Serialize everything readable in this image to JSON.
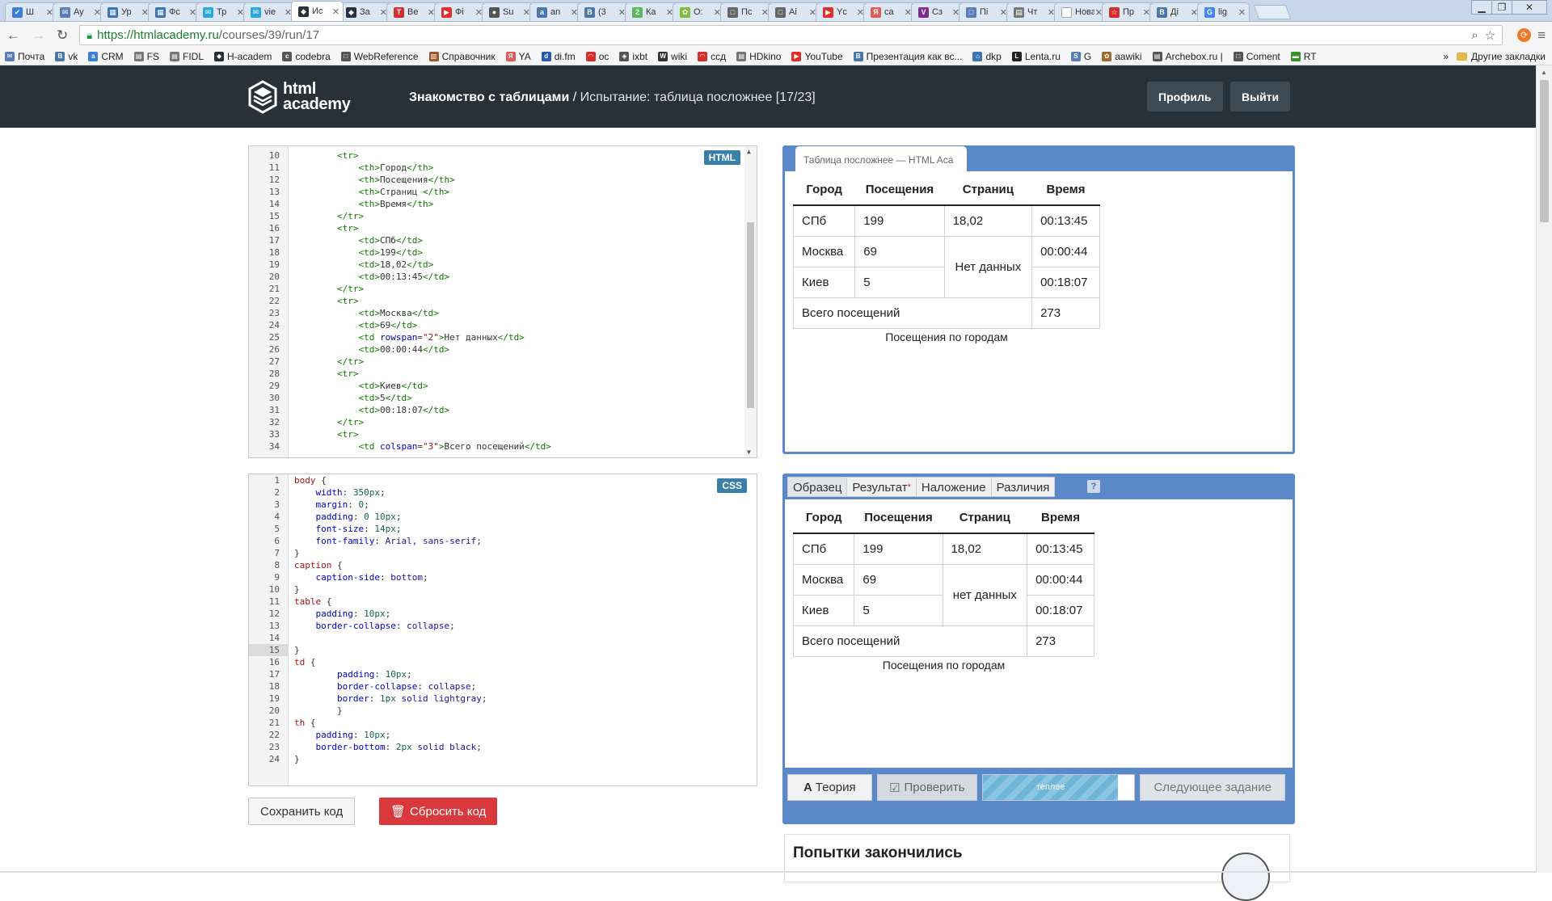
{
  "browser": {
    "tabs": [
      {
        "label": "Ш",
        "color": "#3b7dd8",
        "glyph": "✔"
      },
      {
        "label": "Ay",
        "color": "#5a7fb5",
        "glyph": "✉"
      },
      {
        "label": "Ур",
        "color": "#3d73b0",
        "glyph": "▦"
      },
      {
        "label": "Фс",
        "color": "#3d73b0",
        "glyph": "▦"
      },
      {
        "label": "Тр",
        "color": "#29a9e0",
        "glyph": "✉"
      },
      {
        "label": "vie",
        "color": "#29a9e0",
        "glyph": "✉"
      },
      {
        "label": "Ис",
        "color": "#283138",
        "glyph": "◆",
        "active": true
      },
      {
        "label": "За",
        "color": "#283138",
        "glyph": "◆"
      },
      {
        "label": "Ве",
        "color": "#d32f2f",
        "glyph": "T"
      },
      {
        "label": "Фі",
        "color": "#e52d27",
        "glyph": "▶"
      },
      {
        "label": "Su",
        "color": "#555555",
        "glyph": "●"
      },
      {
        "label": "an",
        "color": "#4a76a8",
        "glyph": "a"
      },
      {
        "label": "(3",
        "color": "#4a76a8",
        "glyph": "B"
      },
      {
        "label": "Ка",
        "color": "#5cb85c",
        "glyph": "2"
      },
      {
        "label": "О:",
        "color": "#7cbf3a",
        "glyph": "✿"
      },
      {
        "label": "Пс",
        "color": "#666666",
        "glyph": "□"
      },
      {
        "label": "Аі",
        "color": "#666666",
        "glyph": "□"
      },
      {
        "label": "Yc",
        "color": "#e52d27",
        "glyph": "▶"
      },
      {
        "label": "са",
        "color": "#e05a5a",
        "glyph": "Я"
      },
      {
        "label": "Сз",
        "color": "#7b2d8e",
        "glyph": "V"
      },
      {
        "label": "Пі",
        "color": "#5a7fb5",
        "glyph": "□"
      },
      {
        "label": "Чт",
        "color": "#777777",
        "glyph": "▤"
      },
      {
        "label": "Нова",
        "color": "#ffffff",
        "glyph": ""
      },
      {
        "label": "Пр",
        "color": "#d32f2f",
        "glyph": "☆"
      },
      {
        "label": "Ді",
        "color": "#4a76a8",
        "glyph": "B"
      },
      {
        "label": "lig",
        "color": "#4285f4",
        "glyph": "G"
      }
    ],
    "url_host": "https://htmlacademy.ru",
    "url_path": "/courses/39/run/17",
    "bookmarks": [
      {
        "label": "Почта",
        "glyph": "✉",
        "color": "#5a7fb5"
      },
      {
        "label": "vk",
        "glyph": "B",
        "color": "#4a76a8"
      },
      {
        "label": "CRM",
        "glyph": "a",
        "color": "#3b7dd8"
      },
      {
        "label": "FS",
        "glyph": "▤",
        "color": "#777777"
      },
      {
        "label": "FIDL",
        "glyph": "▤",
        "color": "#777777"
      },
      {
        "label": "H-academ",
        "glyph": "◆",
        "color": "#283138"
      },
      {
        "label": "codebra",
        "glyph": "c",
        "color": "#555555"
      },
      {
        "label": "WebReference",
        "glyph": "□",
        "color": "#555555"
      },
      {
        "label": "Справочник",
        "glyph": "▥",
        "color": "#a0522d"
      },
      {
        "label": "YA",
        "glyph": "Я",
        "color": "#e05a5a"
      },
      {
        "label": "di.fm",
        "glyph": "d",
        "color": "#2a5ab0"
      },
      {
        "label": "ос",
        "glyph": "◠",
        "color": "#d32f2f"
      },
      {
        "label": "ixbt",
        "glyph": "◈",
        "color": "#555555"
      },
      {
        "label": "wiki",
        "glyph": "W",
        "color": "#333333"
      },
      {
        "label": "ссд",
        "glyph": "◠",
        "color": "#d32f2f"
      },
      {
        "label": "HDkino",
        "glyph": "▤",
        "color": "#777777"
      },
      {
        "label": "YouTube",
        "glyph": "▶",
        "color": "#e52d27"
      },
      {
        "label": "Презентация как вс...",
        "glyph": "B",
        "color": "#4a76a8"
      },
      {
        "label": "dkp",
        "glyph": "⌂",
        "color": "#3d73b0"
      },
      {
        "label": "Lenta.ru",
        "glyph": "L",
        "color": "#222222"
      },
      {
        "label": "G",
        "glyph": "S",
        "color": "#5a7fb5"
      },
      {
        "label": "aawiki",
        "glyph": "✿",
        "color": "#a06a2a"
      },
      {
        "label": "Archebox.ru |",
        "glyph": "▤",
        "color": "#555555"
      },
      {
        "label": "Coment",
        "glyph": "□",
        "color": "#555555"
      },
      {
        "label": "RT",
        "glyph": "▬",
        "color": "#3a8f2a"
      }
    ],
    "bookmarks_more": "»",
    "other_bookmarks": "Другие закладки"
  },
  "header": {
    "logo_line1": "html",
    "logo_line2": "academy",
    "course": "Знакомство с таблицами",
    "separator": " / ",
    "task": "Испытание: таблица посложнее",
    "progress": "[17/23]",
    "profile_btn": "Профиль",
    "logout_btn": "Выйти"
  },
  "html_editor": {
    "badge": "HTML",
    "lines": [
      {
        "n": "10",
        "indent": "        ",
        "html": "<span class='t-tag'>&lt;tr&gt;</span>"
      },
      {
        "n": "11",
        "indent": "            ",
        "html": "<span class='t-tag'>&lt;th&gt;</span>Город<span class='t-tag'>&lt;/th&gt;</span>"
      },
      {
        "n": "12",
        "indent": "            ",
        "html": "<span class='t-tag'>&lt;th&gt;</span>Посещения<span class='t-tag'>&lt;/th&gt;</span>"
      },
      {
        "n": "13",
        "indent": "            ",
        "html": "<span class='t-tag'>&lt;th&gt;</span>Страниц <span class='t-tag'>&lt;/th&gt;</span>"
      },
      {
        "n": "14",
        "indent": "            ",
        "html": "<span class='t-tag'>&lt;th&gt;</span>Время<span class='t-tag'>&lt;/th&gt;</span>"
      },
      {
        "n": "15",
        "indent": "        ",
        "html": "<span class='t-tag'>&lt;/tr&gt;</span>"
      },
      {
        "n": "16",
        "indent": "        ",
        "html": "<span class='t-tag'>&lt;tr&gt;</span>"
      },
      {
        "n": "17",
        "indent": "            ",
        "html": "<span class='t-tag'>&lt;td&gt;</span>СПб<span class='t-tag'>&lt;/td&gt;</span>"
      },
      {
        "n": "18",
        "indent": "            ",
        "html": "<span class='t-tag'>&lt;td&gt;</span>199<span class='t-tag'>&lt;/td&gt;</span>"
      },
      {
        "n": "19",
        "indent": "            ",
        "html": "<span class='t-tag'>&lt;td&gt;</span>18,02<span class='t-tag'>&lt;/td&gt;</span>"
      },
      {
        "n": "20",
        "indent": "            ",
        "html": "<span class='t-tag'>&lt;td&gt;</span>00:13:45<span class='t-tag'>&lt;/td&gt;</span>"
      },
      {
        "n": "21",
        "indent": "        ",
        "html": "<span class='t-tag'>&lt;/tr&gt;</span>"
      },
      {
        "n": "22",
        "indent": "        ",
        "html": "<span class='t-tag'>&lt;tr&gt;</span>"
      },
      {
        "n": "23",
        "indent": "            ",
        "html": "<span class='t-tag'>&lt;td&gt;</span>Москва<span class='t-tag'>&lt;/td&gt;</span>"
      },
      {
        "n": "24",
        "indent": "            ",
        "html": "<span class='t-tag'>&lt;td&gt;</span>69<span class='t-tag'>&lt;/td&gt;</span>"
      },
      {
        "n": "25",
        "indent": "            ",
        "html": "<span class='t-tag'>&lt;td</span> <span class='t-attr'>rowspan</span>=<span class='t-str'>\"2\"</span><span class='t-tag'>&gt;</span>Нет данных<span class='t-tag'>&lt;/td&gt;</span>"
      },
      {
        "n": "26",
        "indent": "            ",
        "html": "<span class='t-tag'>&lt;td&gt;</span>00:00:44<span class='t-tag'>&lt;/td&gt;</span>"
      },
      {
        "n": "27",
        "indent": "        ",
        "html": "<span class='t-tag'>&lt;/tr&gt;</span>"
      },
      {
        "n": "28",
        "indent": "        ",
        "html": "<span class='t-tag'>&lt;tr&gt;</span>"
      },
      {
        "n": "29",
        "indent": "            ",
        "html": "<span class='t-tag'>&lt;td&gt;</span>Киев<span class='t-tag'>&lt;/td&gt;</span>"
      },
      {
        "n": "30",
        "indent": "            ",
        "html": "<span class='t-tag'>&lt;td&gt;</span>5<span class='t-tag'>&lt;/td&gt;</span>"
      },
      {
        "n": "31",
        "indent": "            ",
        "html": "<span class='t-tag'>&lt;td&gt;</span>00:18:07<span class='t-tag'>&lt;/td&gt;</span>"
      },
      {
        "n": "32",
        "indent": "        ",
        "html": "<span class='t-tag'>&lt;/tr&gt;</span>"
      },
      {
        "n": "33",
        "indent": "        ",
        "html": "<span class='t-tag'>&lt;tr&gt;</span>"
      },
      {
        "n": "34",
        "indent": "            ",
        "html": "<span class='t-tag'>&lt;td</span> <span class='t-attr'>colspan</span>=<span class='t-str'>\"3\"</span><span class='t-tag'>&gt;</span>Всего посещений<span class='t-tag'>&lt;/td&gt;</span>"
      }
    ]
  },
  "css_editor": {
    "badge": "CSS",
    "highlight_line": "15",
    "lines": [
      {
        "n": "1",
        "html": "<span class='c-sel'>body</span> {"
      },
      {
        "n": "2",
        "html": "    <span class='c-prop'>width</span>: <span class='c-num'>350px</span>;"
      },
      {
        "n": "3",
        "html": "    <span class='c-prop'>margin</span>: <span class='c-num'>0</span>;"
      },
      {
        "n": "4",
        "html": "    <span class='c-prop'>padding</span>: <span class='c-num'>0</span> <span class='c-num'>10px</span>;"
      },
      {
        "n": "5",
        "html": "    <span class='c-prop'>font-size</span>: <span class='c-num'>14px</span>;"
      },
      {
        "n": "6",
        "html": "    <span class='c-prop'>font-family</span>: <span class='c-val'>Arial, sans-serif</span>;"
      },
      {
        "n": "7",
        "html": "}"
      },
      {
        "n": "8",
        "html": "<span class='c-sel'>caption</span> {"
      },
      {
        "n": "9",
        "html": "    <span class='c-prop'>caption-side</span>: <span class='c-val'>bottom</span>;"
      },
      {
        "n": "10",
        "html": "}"
      },
      {
        "n": "11",
        "html": "<span class='c-sel'>table</span> {"
      },
      {
        "n": "12",
        "html": "    <span class='c-prop'>padding</span>: <span class='c-num'>10px</span>;"
      },
      {
        "n": "13",
        "html": "    <span class='c-prop'>border-collapse</span>: <span class='c-val'>collapse</span>;"
      },
      {
        "n": "14",
        "html": ""
      },
      {
        "n": "15",
        "html": "}"
      },
      {
        "n": "16",
        "html": "<span class='c-sel'>td</span> {"
      },
      {
        "n": "17",
        "html": "        <span class='c-prop'>padding</span>: <span class='c-num'>10px</span>;"
      },
      {
        "n": "18",
        "html": "        <span class='c-prop'>border-collapse</span>: <span class='c-val'>collapse</span>;"
      },
      {
        "n": "19",
        "html": "        <span class='c-prop'>border</span>: <span class='c-num'>1px</span> <span class='c-val'>solid lightgray</span>;"
      },
      {
        "n": "20",
        "html": "        }"
      },
      {
        "n": "21",
        "html": "<span class='c-sel'>th</span> {"
      },
      {
        "n": "22",
        "html": "    <span class='c-prop'>padding</span>: <span class='c-num'>10px</span>;"
      },
      {
        "n": "23",
        "html": "    <span class='c-prop'>border-bottom</span>: <span class='c-num'>2px</span> <span class='c-val'>solid black</span>;"
      },
      {
        "n": "24",
        "html": "}"
      }
    ]
  },
  "result_panel": {
    "tab_title": "Таблица посложнее — HTML Aca",
    "headers": [
      "Город",
      "Посещения",
      "Страниц",
      "Время"
    ],
    "rows": [
      [
        "СПб",
        "199",
        "18,02",
        "00:13:45"
      ],
      [
        "Москва",
        "69",
        "Нет данных",
        "00:00:44"
      ],
      [
        "Киев",
        "5",
        "",
        "00:18:07"
      ]
    ],
    "total_label": "Всего посещений",
    "total_value": "273",
    "caption": "Посещения по городам"
  },
  "sample_panel": {
    "tabs": [
      "Образец",
      "Результат",
      "Наложение",
      "Различия"
    ],
    "result_marker": "*",
    "help": "?",
    "headers": [
      "Город",
      "Посещения",
      "Страниц",
      "Время"
    ],
    "rows": [
      [
        "СПб",
        "199",
        "18,02",
        "00:13:45"
      ],
      [
        "Москва",
        "69",
        "нет данных",
        "00:00:44"
      ],
      [
        "Киев",
        "5",
        "",
        "00:18:07"
      ]
    ],
    "total_label": "Всего посещений",
    "total_value": "273",
    "caption": "Посещения по городам"
  },
  "actions": {
    "theory": "Теория",
    "check": "Проверить",
    "progress_text": "теплее",
    "progress_fraction": 0.89,
    "next": "Следующее задание",
    "save_code": "Сохранить код",
    "reset_code": "Сбросить код"
  },
  "attempts": {
    "title": "Попытки закончились"
  }
}
